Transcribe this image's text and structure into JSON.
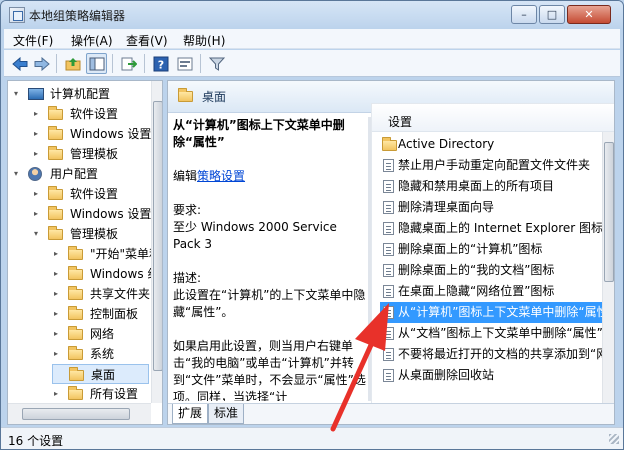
{
  "window": {
    "title": "本地组策略编辑器"
  },
  "title_buttons": {
    "minimize": "–",
    "maximize": "□",
    "close": "✕"
  },
  "menu": [
    {
      "label": "文件(F)"
    },
    {
      "label": "操作(A)"
    },
    {
      "label": "查看(V)"
    },
    {
      "label": "帮助(H)"
    }
  ],
  "toolbar": {
    "back": "back-arrow-icon",
    "forward": "forward-arrow-icon",
    "up": "up-folder-icon",
    "show_hide_tree": "console-tree-icon",
    "export": "export-list-icon",
    "help": "help-icon",
    "properties": "properties-icon",
    "filter": "filter-icon"
  },
  "tree": [
    {
      "label": "计算机配置",
      "icon": "computer-icon",
      "expanded": true
    },
    {
      "label": "软件设置",
      "icon": "folder-icon"
    },
    {
      "label": "Windows 设置",
      "icon": "folder-icon"
    },
    {
      "label": "管理模板",
      "icon": "folder-icon"
    },
    {
      "label": "用户配置",
      "icon": "user-icon",
      "expanded": true
    },
    {
      "label": "软件设置",
      "icon": "folder-icon"
    },
    {
      "label": "Windows 设置",
      "icon": "folder-icon"
    },
    {
      "label": "管理模板",
      "icon": "folder-icon",
      "expanded": true
    },
    {
      "label": "\"开始\"菜单和任务栏",
      "icon": "folder-icon"
    },
    {
      "label": "Windows 组件",
      "icon": "folder-icon"
    },
    {
      "label": "共享文件夹",
      "icon": "folder-icon"
    },
    {
      "label": "控制面板",
      "icon": "folder-icon"
    },
    {
      "label": "网络",
      "icon": "folder-icon"
    },
    {
      "label": "系统",
      "icon": "folder-icon"
    },
    {
      "label": "桌面",
      "icon": "folder-icon",
      "selected": true
    },
    {
      "label": "所有设置",
      "icon": "folder-icon"
    }
  ],
  "right_header": {
    "title": "桌面"
  },
  "description": {
    "title": "从“计算机”图标上下文菜单中删除“属性”",
    "edit_prefix": "编辑",
    "edit_link": "策略设置",
    "requirements_label": "要求:",
    "requirements_text": "至少 Windows 2000 Service Pack 3",
    "desc_label": "描述:",
    "desc_text": "此设置在“计算机”的上下文菜单中隐藏“属性”。",
    "more_text": "如果启用此设置，则当用户右键单击“我的电脑”或单击“计算机”并转到“文件”菜单时，不会显示“属性”选项。同样，当选择“计"
  },
  "settings_header": "设置",
  "settings": [
    {
      "label": "Active Directory",
      "icon": "folder-icon"
    },
    {
      "label": "禁止用户手动重定向配置文件文件夹",
      "icon": "policy-icon"
    },
    {
      "label": "隐藏和禁用桌面上的所有项目",
      "icon": "policy-icon"
    },
    {
      "label": "删除清理桌面向导",
      "icon": "policy-icon"
    },
    {
      "label": "隐藏桌面上的 Internet Explorer 图标",
      "icon": "policy-icon"
    },
    {
      "label": "删除桌面上的“计算机”图标",
      "icon": "policy-icon"
    },
    {
      "label": "删除桌面上的“我的文档”图标",
      "icon": "policy-icon"
    },
    {
      "label": "在桌面上隐藏“网络位置”图标",
      "icon": "policy-icon"
    },
    {
      "label": "从“计算机”图标上下文菜单中删除“属性”",
      "icon": "policy-icon",
      "selected": true
    },
    {
      "label": "从“文档”图标上下文菜单中删除“属性”",
      "icon": "policy-icon"
    },
    {
      "label": "不要将最近打开的文档的共享添加到“网络位置”",
      "icon": "policy-icon"
    },
    {
      "label": "从桌面删除回收站",
      "icon": "policy-icon"
    }
  ],
  "tabs": [
    {
      "label": "扩展",
      "active": true
    },
    {
      "label": "标准",
      "active": false
    }
  ],
  "status": {
    "text": "16 个设置"
  },
  "colors": {
    "selection": "#3399ff",
    "link": "#0046d5",
    "annotation_arrow": "#e8312a"
  }
}
